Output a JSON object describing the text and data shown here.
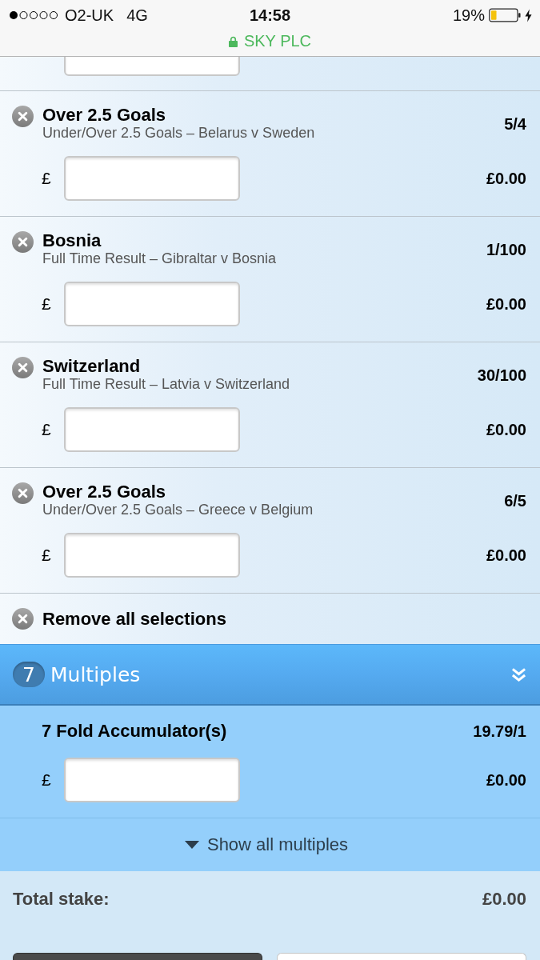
{
  "status_bar": {
    "carrier": "O2-UK",
    "network": "4G",
    "time": "14:58",
    "battery": "19%",
    "url": "SKY PLC"
  },
  "selections": [
    {
      "title": "Over 2.5 Goals",
      "market": "Under/Over 2.5 Goals – Belarus v Sweden",
      "odds": "5/4",
      "currency": "£",
      "returns": "£0.00"
    },
    {
      "title": "Bosnia",
      "market": "Full Time Result – Gibraltar v Bosnia",
      "odds": "1/100",
      "currency": "£",
      "returns": "£0.00"
    },
    {
      "title": "Switzerland",
      "market": "Full Time Result – Latvia v Switzerland",
      "odds": "30/100",
      "currency": "£",
      "returns": "£0.00"
    },
    {
      "title": "Over 2.5 Goals",
      "market": "Under/Over 2.5 Goals – Greece v Belgium",
      "odds": "6/5",
      "currency": "£",
      "returns": "£0.00"
    }
  ],
  "remove_all": {
    "label": "Remove all selections"
  },
  "multiples": {
    "count": "7",
    "title": "Multiples"
  },
  "accumulator": {
    "title": "7 Fold Accumulator(s)",
    "odds": "19.79/1",
    "currency": "£",
    "returns": "£0.00"
  },
  "show_all": {
    "label": "Show all multiples"
  },
  "total": {
    "label": "Total stake:",
    "value": "£0.00"
  },
  "footer_buttons": [
    {
      "kind": "primary"
    },
    {
      "kind": "secondary"
    }
  ]
}
